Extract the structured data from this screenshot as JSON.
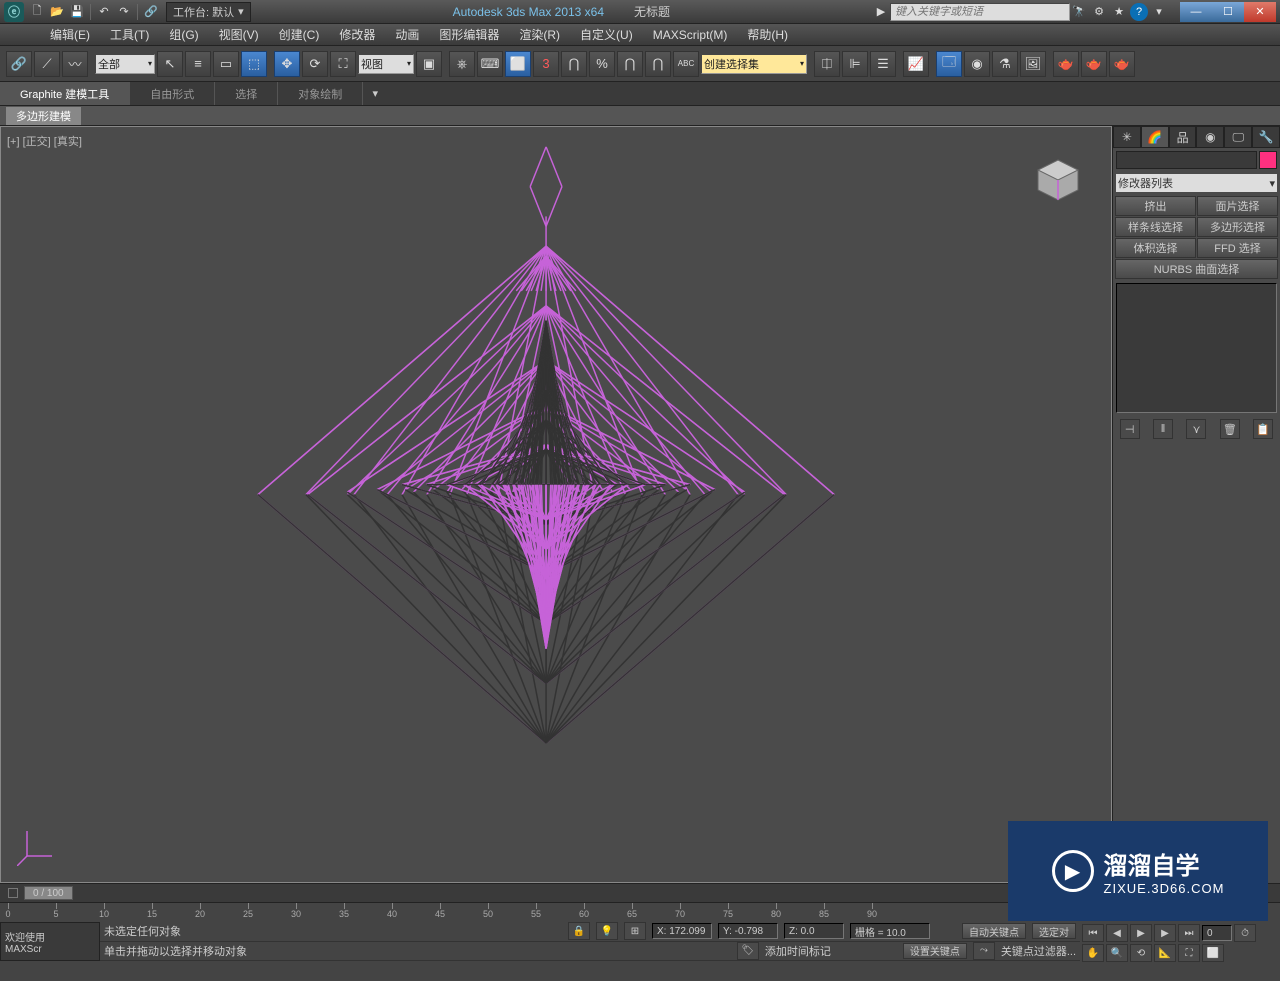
{
  "titlebar": {
    "workspace_label": "工作台: 默认",
    "app": "Autodesk 3ds Max  2013 x64",
    "doc": "无标题",
    "search_placeholder": "键入关键字或短语"
  },
  "menu": [
    "编辑(E)",
    "工具(T)",
    "组(G)",
    "视图(V)",
    "创建(C)",
    "修改器",
    "动画",
    "图形编辑器",
    "渲染(R)",
    "自定义(U)",
    "MAXScript(M)",
    "帮助(H)"
  ],
  "toolbar": {
    "filter": "全部",
    "view": "视图",
    "selset": "创建选择集"
  },
  "ribbon": {
    "tabs": [
      "Graphite 建模工具",
      "自由形式",
      "选择",
      "对象绘制"
    ],
    "subtab": "多边形建模"
  },
  "viewport": {
    "label": "[+] [正交] [真实]"
  },
  "cmdpanel": {
    "modifier_list": "修改器列表",
    "buttons": [
      "挤出",
      "面片选择",
      "样条线选择",
      "多边形选择",
      "体积选择",
      "FFD 选择"
    ],
    "nurbs": "NURBS 曲面选择"
  },
  "timeline": {
    "slider": "0 / 100",
    "ticks": [
      0,
      5,
      10,
      15,
      20,
      25,
      30,
      35,
      40,
      45,
      50,
      55,
      60,
      65,
      70,
      75,
      80,
      85,
      90
    ]
  },
  "status": {
    "welcome1": "欢迎使用",
    "welcome2": "MAXScr",
    "sel": "未选定任何对象",
    "hint": "单击并拖动以选择并移动对象",
    "x": "X: 172.099",
    "y": "Y: -0.798",
    "z": "Z: 0.0",
    "grid": "栅格 = 10.0",
    "addtag": "添加时间标记",
    "autokey": "自动关键点",
    "setkey": "设置关键点",
    "selsetbtn": "选定对",
    "keyfilter": "关键点过滤器..."
  },
  "watermark": {
    "cn": "溜溜自学",
    "en": "ZIXUE.3D66.COM"
  }
}
